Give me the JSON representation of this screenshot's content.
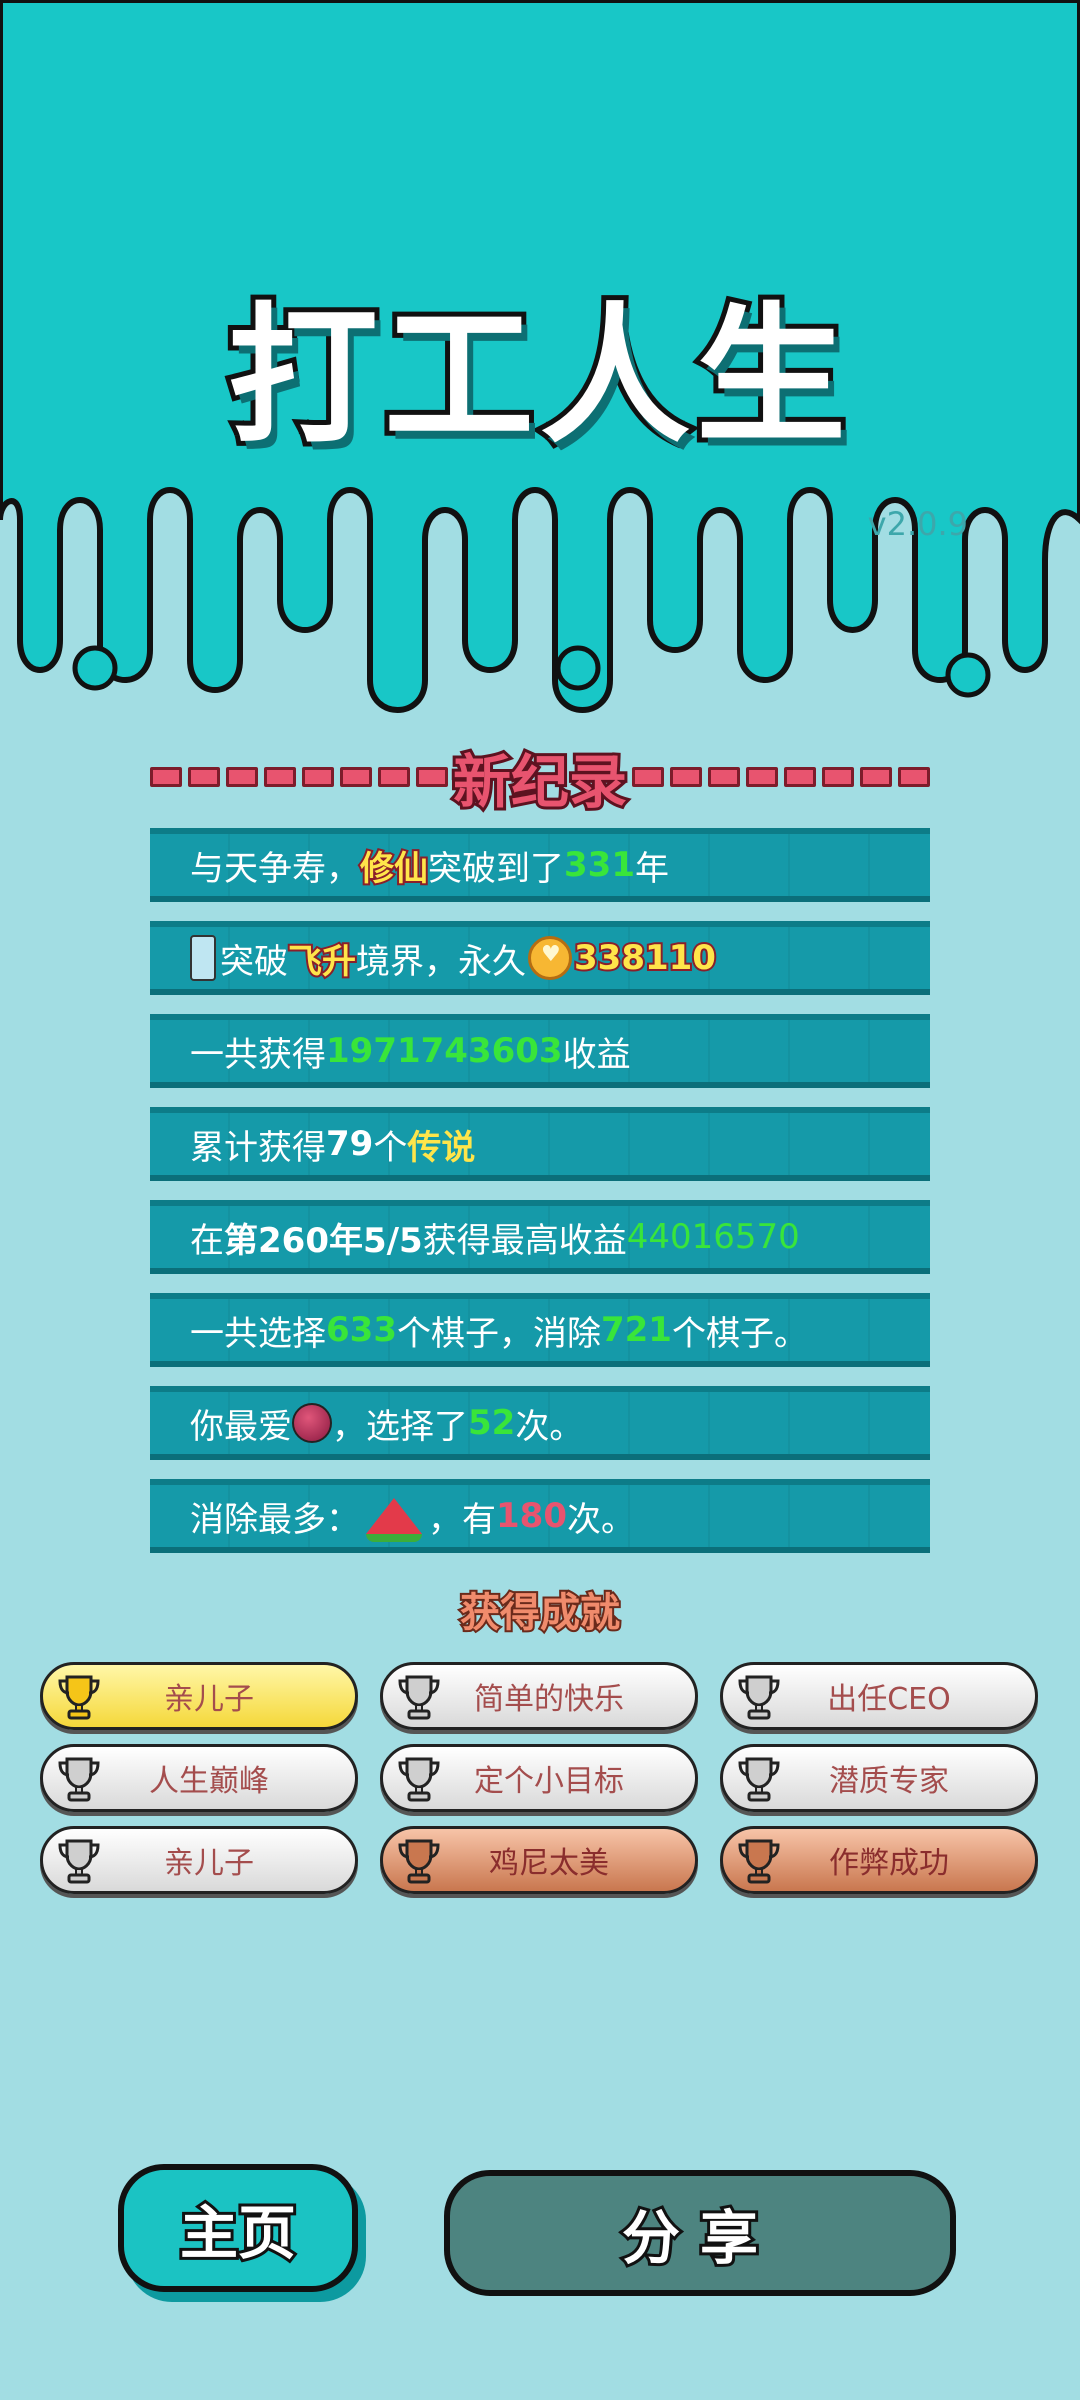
{
  "header": {
    "title": "打工人生",
    "version": "v2.0.9"
  },
  "record": {
    "title": "新纪录"
  },
  "stats": {
    "row1": {
      "a": "与天争寿，",
      "b": "修仙",
      "c": "突破到了",
      "d": "331",
      "e": "年"
    },
    "row2": {
      "a": "突破",
      "b": "飞升",
      "c": "境界，永久",
      "d": "338110"
    },
    "row3": {
      "a": "一共获得",
      "b": "1971743603",
      "c": "收益"
    },
    "row4": {
      "a": "累计获得",
      "b": "79",
      "c": "个",
      "d": "传说"
    },
    "row5": {
      "a": "在 ",
      "b": "第260年5/5",
      "c": " 获得最高收益",
      "d": "44016570"
    },
    "row6": {
      "a": "一共选择",
      "b": "633",
      "c": "个棋子，消除",
      "d": "721",
      "e": "个棋子。"
    },
    "row7": {
      "a": "你最爱",
      "b": "，选择了",
      "c": "52",
      "d": "次。"
    },
    "row8": {
      "a": "消除最多：",
      "b": "，有",
      "c": "180",
      "d": "次。"
    }
  },
  "achievements": {
    "title": "获得成就",
    "items": [
      {
        "label": "亲儿子",
        "tier": "gold"
      },
      {
        "label": "简单的快乐",
        "tier": "silver"
      },
      {
        "label": "出任CEO",
        "tier": "silver"
      },
      {
        "label": "人生巅峰",
        "tier": "silver"
      },
      {
        "label": "定个小目标",
        "tier": "silver"
      },
      {
        "label": "潜质专家",
        "tier": "silver"
      },
      {
        "label": "亲儿子",
        "tier": "silver"
      },
      {
        "label": "鸡尼太美",
        "tier": "bronze"
      },
      {
        "label": "作弊成功",
        "tier": "bronze"
      }
    ]
  },
  "buttons": {
    "home": "主页",
    "share": "分享"
  },
  "colors": {
    "header_bg": "#18c7c7",
    "page_bg": "#a2dde3",
    "row_bg": "#159aa9",
    "green_value": "#39e53a",
    "accent_red": "#e8546f"
  }
}
